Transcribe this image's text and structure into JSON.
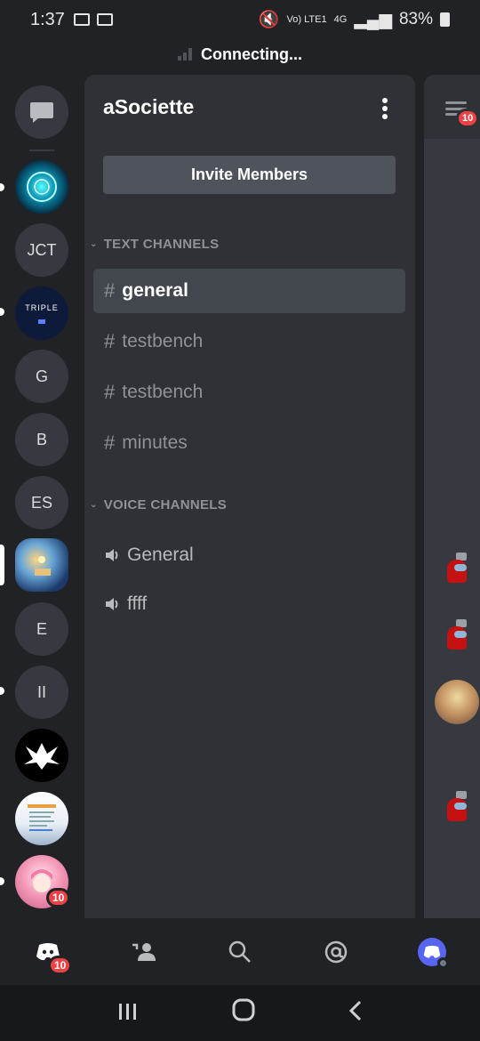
{
  "status_bar": {
    "time": "1:37",
    "carrier": "Vo) LTE1",
    "network": "4G",
    "battery": "83%"
  },
  "connection": {
    "text": "Connecting..."
  },
  "server_rail": {
    "servers": [
      {
        "label": "",
        "kind": "image"
      },
      {
        "label": "JCT",
        "kind": "text"
      },
      {
        "label": "TRIPLE",
        "kind": "image"
      },
      {
        "label": "G",
        "kind": "text"
      },
      {
        "label": "B",
        "kind": "text"
      },
      {
        "label": "ES",
        "kind": "text"
      },
      {
        "label": "",
        "kind": "image"
      },
      {
        "label": "E",
        "kind": "text"
      },
      {
        "label": "II",
        "kind": "text"
      },
      {
        "label": "",
        "kind": "image"
      },
      {
        "label": "",
        "kind": "image"
      },
      {
        "label": "",
        "kind": "image",
        "badge": "10"
      }
    ]
  },
  "channel_panel": {
    "server_name": "aSociette",
    "invite_label": "Invite Members",
    "categories": {
      "text": "TEXT CHANNELS",
      "voice": "VOICE CHANNELS"
    },
    "text_channels": [
      "general",
      "testbench",
      "testbench",
      "minutes"
    ],
    "voice_channels": [
      "General",
      "ffff"
    ]
  },
  "peek": {
    "badge": "10"
  },
  "bottom_nav": {
    "home_badge": "10"
  },
  "colors": {
    "background": "#202225",
    "panel": "#2f3136",
    "active_channel": "#42464d",
    "badge": "#ed4245",
    "accent": "#5865f2"
  }
}
